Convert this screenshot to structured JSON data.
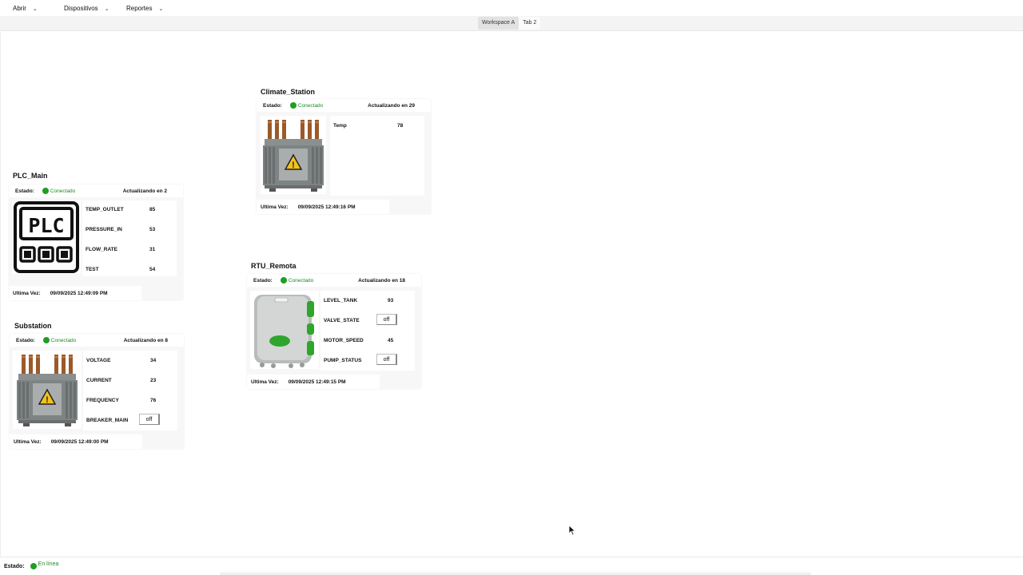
{
  "menubar": {
    "items": [
      {
        "label": "Abrir"
      },
      {
        "label": "Dispositivos"
      },
      {
        "label": "Reportes"
      }
    ]
  },
  "tabs": [
    {
      "label": "Workspace A",
      "active": true
    },
    {
      "label": "Tab 2",
      "active": false
    }
  ],
  "common": {
    "estado_label": "Estado:",
    "conectado": "Conectado",
    "ultima_vez_label": "Ultima Vez:",
    "toggle_off": "off"
  },
  "devices": {
    "plc": {
      "name": "PLC_Main",
      "updating": "Actualizando en 2",
      "last_seen": "09/09/2025 12:49:09 PM",
      "image": "plc-icon",
      "values": [
        {
          "key": "TEMP_OUTLET",
          "value": "85"
        },
        {
          "key": "PRESSURE_IN",
          "value": "53"
        },
        {
          "key": "FLOW_RATE",
          "value": "31"
        },
        {
          "key": "TEST",
          "value": "54"
        }
      ]
    },
    "substation": {
      "name": "Substation",
      "updating": "Actualizando en 8",
      "last_seen": "09/09/2025 12:49:00 PM",
      "image": "transformer-icon",
      "values": [
        {
          "key": "VOLTAGE",
          "value": "34"
        },
        {
          "key": "CURRENT",
          "value": "23"
        },
        {
          "key": "FREQUENCY",
          "value": "76"
        },
        {
          "key": "BREAKER_MAIN",
          "value": "off",
          "type": "toggle"
        }
      ]
    },
    "climate": {
      "name": "Climate_Station",
      "updating": "Actualizando en 29",
      "last_seen": "09/09/2025 12:49:16 PM",
      "image": "transformer-icon",
      "values": [
        {
          "key": "Temp",
          "value": "78"
        }
      ]
    },
    "rtu": {
      "name": "RTU_Remota",
      "updating": "Actualizando en 18",
      "last_seen": "09/09/2025 12:49:15 PM",
      "image": "rtu-enclosure-icon",
      "values": [
        {
          "key": "LEVEL_TANK",
          "value": "93"
        },
        {
          "key": "VALVE_STATE",
          "value": "off",
          "type": "toggle"
        },
        {
          "key": "MOTOR_SPEED",
          "value": "45"
        },
        {
          "key": "PUMP_STATUS",
          "value": "off",
          "type": "toggle"
        }
      ]
    }
  },
  "statusbar": {
    "estado_label": "Estado:",
    "status": "En línea"
  },
  "colors": {
    "connected_green": "#1e9e22",
    "tab_active_bg": "#e2e2e2"
  }
}
